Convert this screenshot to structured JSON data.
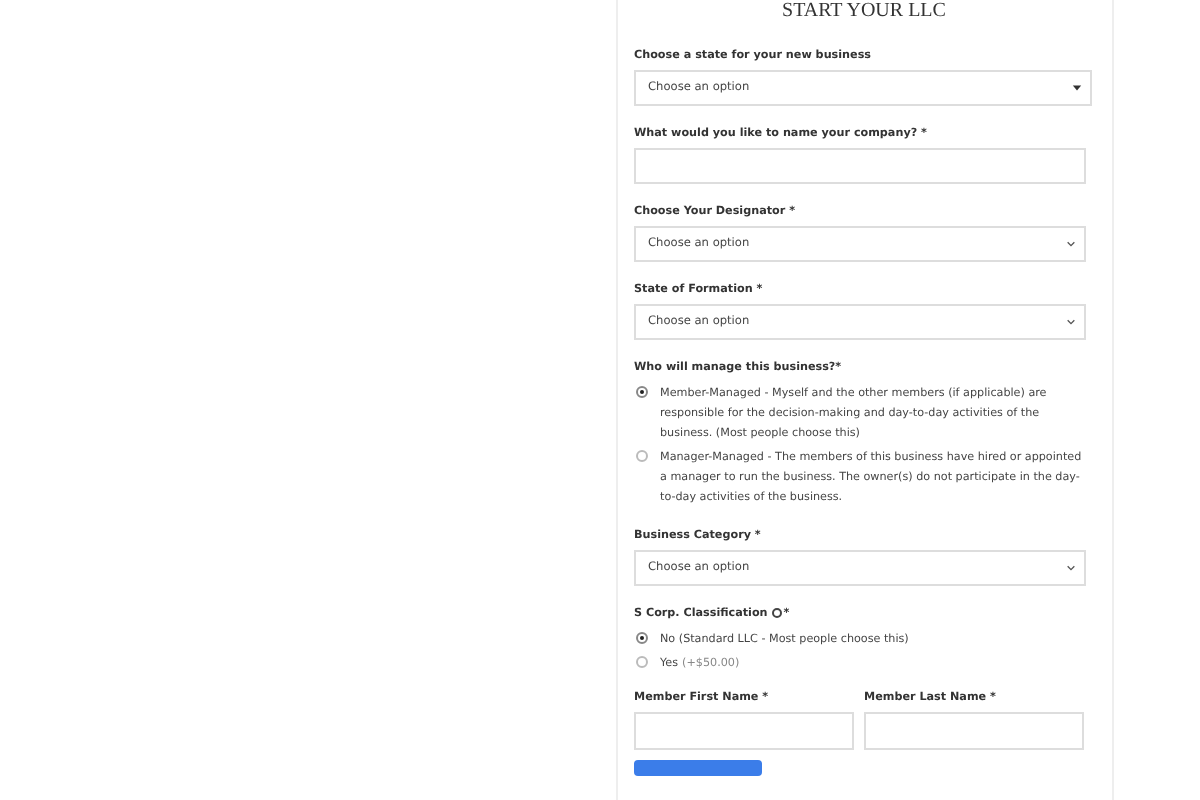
{
  "title": "START YOUR LLC",
  "fields": [
    {
      "kind": "select",
      "label": "Choose a state for your new business",
      "value": "Choose an option",
      "caret_filled": true
    },
    {
      "kind": "text",
      "label": "What would you like to name your company? *"
    },
    {
      "kind": "select",
      "label": "Choose Your Designator *",
      "value": "Choose an option",
      "caret_filled": false
    },
    {
      "kind": "select",
      "label": "State of Formation *",
      "value": "Choose an option",
      "caret_filled": false
    },
    {
      "kind": "radio",
      "label": "Who will manage this business?*",
      "options": [
        {
          "text": "Member-Managed - Myself and the other members (if applicable) are responsible for the decision-making and day-to-day activities of the business. (Most people choose this)",
          "selected": true
        },
        {
          "text": "Manager-Managed - The members of this business have hired or appointed a manager to run the business. The owner(s) do not participate in the day-to-day activities of the business.",
          "selected": false
        }
      ]
    },
    {
      "kind": "select",
      "label": "Business Category *",
      "value": "Choose an option",
      "caret_filled": false
    },
    {
      "kind": "radio",
      "label": "S Corp. Classification",
      "info": true,
      "label_suffix": "*",
      "options": [
        {
          "text": "No (Standard LLC - Most people choose this)",
          "selected": true
        },
        {
          "text": "Yes",
          "note": "(+$50.00)",
          "selected": false
        }
      ]
    },
    {
      "kind": "pair",
      "items": [
        {
          "label": "Member First Name *"
        },
        {
          "label": "Member Last Name *"
        }
      ]
    }
  ]
}
